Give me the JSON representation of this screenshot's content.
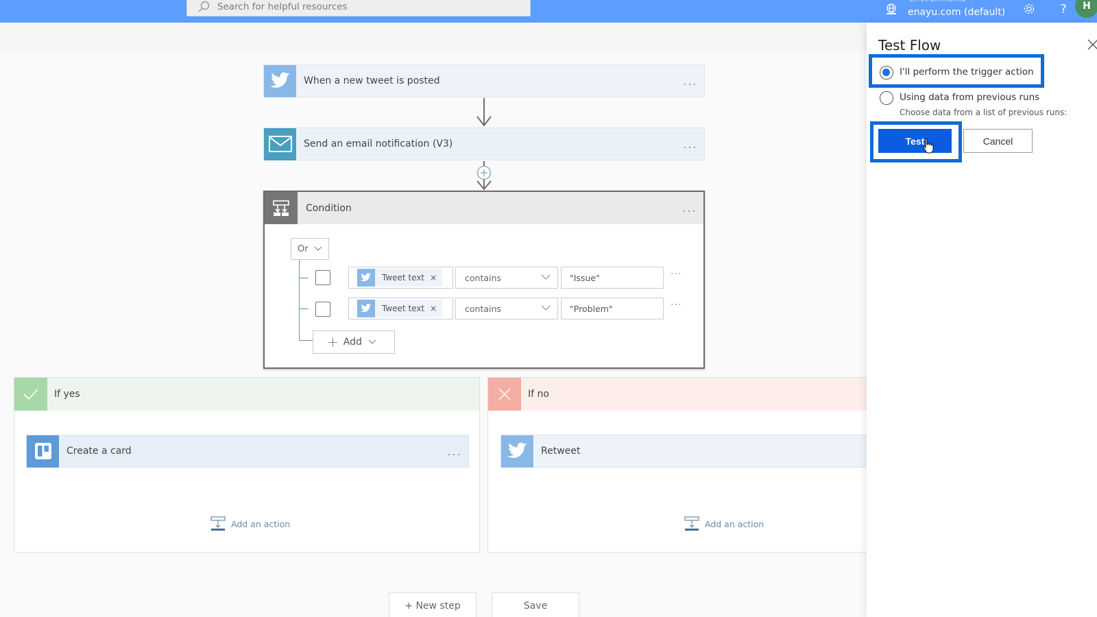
{
  "topbar": {
    "search_placeholder": "Search for helpful resources",
    "environment_label": "Environments",
    "environment_name": "enayu.com (default)",
    "avatar_initial": "H",
    "icons": [
      "globe-icon",
      "gear-icon",
      "help-icon"
    ]
  },
  "flow": {
    "trigger": {
      "title": "When a new tweet is posted",
      "icon": "twitter-icon",
      "more": "..."
    },
    "email_step": {
      "title": "Send an email notification (V3)",
      "icon": "mail-icon",
      "more": "..."
    },
    "condition": {
      "title": "Condition",
      "more": "...",
      "group_operator": "Or",
      "rows": [
        {
          "token": "Tweet text",
          "operator": "contains",
          "value": "\"Issue\""
        },
        {
          "token": "Tweet text",
          "operator": "contains",
          "value": "\"Problem\""
        }
      ],
      "add_label": "Add"
    },
    "if_yes": {
      "title": "If yes",
      "action": {
        "title": "Create a card",
        "icon": "trello-icon",
        "more": "..."
      },
      "add_action_label": "Add an action"
    },
    "if_no": {
      "title": "If no",
      "action": {
        "title": "Retweet",
        "icon": "twitter-icon"
      },
      "add_action_label": "Add an action"
    },
    "new_step_label": "+ New step",
    "save_label": "Save"
  },
  "panel": {
    "title": "Test Flow",
    "options": [
      {
        "label": "I'll perform the trigger action",
        "selected": true
      },
      {
        "label": "Using data from previous runs",
        "selected": false,
        "sub": "Choose data from a list of previous runs:"
      }
    ],
    "test_label": "Test",
    "cancel_label": "Cancel"
  },
  "colors": {
    "topbar": "#5c9dff",
    "primary_button": "#0b5ce0",
    "highlight_border": "#0f6cd6",
    "twitter": "#8ab8e6",
    "mail": "#4a9fc0",
    "trello": "#5c9ad8",
    "yes": "#a8d8a8",
    "no": "#f4ada2"
  }
}
